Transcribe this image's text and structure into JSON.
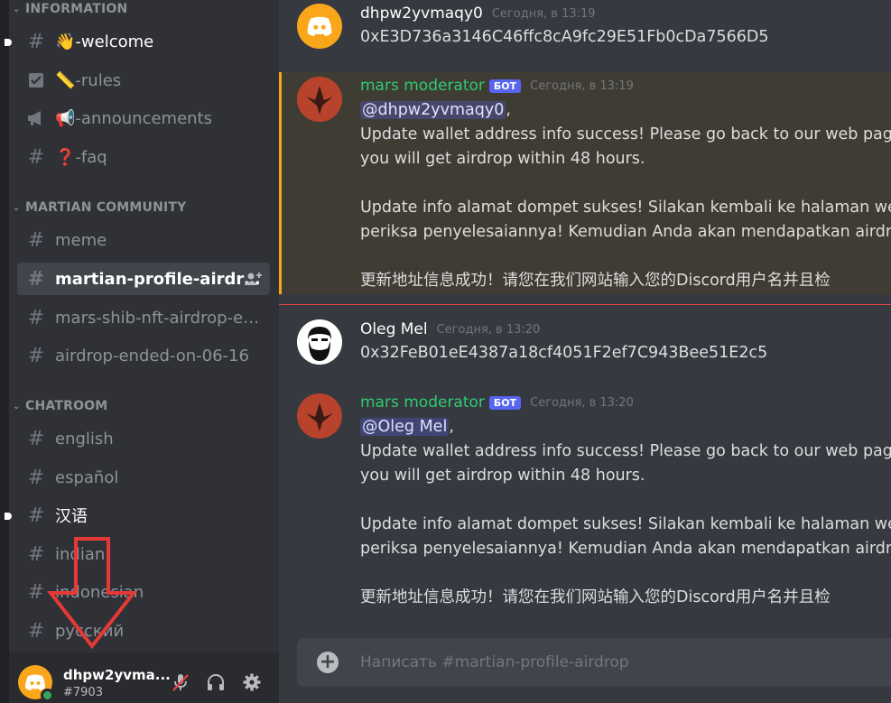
{
  "sidebar": {
    "categories": [
      {
        "label": "INFORMATION"
      },
      {
        "label": "MARTIAN COMMUNITY"
      },
      {
        "label": "CHATROOM"
      }
    ],
    "information_channels": [
      {
        "label": "👋-welcome",
        "icon": "hash-icon"
      },
      {
        "label": "📏-rules",
        "icon": "rules-checkbox-icon"
      },
      {
        "label": "📢-announcements",
        "icon": "megaphone-icon"
      },
      {
        "label": "❓-faq",
        "icon": "hash-icon"
      }
    ],
    "community_channels": [
      {
        "label": "meme",
        "icon": "hash-icon"
      },
      {
        "label": "martian-profile-airdrop",
        "icon": "hash-icon",
        "active": true
      },
      {
        "label": "mars-shib-nft-airdrop-en...",
        "icon": "hash-icon"
      },
      {
        "label": "airdrop-ended-on-06-16",
        "icon": "hash-icon"
      }
    ],
    "chatroom_channels": [
      {
        "label": "english",
        "icon": "hash-icon"
      },
      {
        "label": "español",
        "icon": "hash-icon"
      },
      {
        "label": "汉语",
        "icon": "hash-icon"
      },
      {
        "label": "indian",
        "icon": "hash-icon"
      },
      {
        "label": "indonesian",
        "icon": "hash-icon"
      },
      {
        "label": "русский",
        "icon": "hash-icon"
      }
    ]
  },
  "user_panel": {
    "username": "dhpw2yvma...",
    "tag": "#7903",
    "status_color": "#3ba55d",
    "avatar_color": "#faa61a"
  },
  "messages": [
    {
      "author": "dhpw2yvmaqy0",
      "timestamp": "Сегодня, в 13:19",
      "lines": [
        "0xE3D736a3146C46ffc8cA9fc29E51Fb0cDa7566D5"
      ]
    },
    {
      "author": "mars moderator",
      "bot": "БОТ",
      "timestamp": "Сегодня, в 13:19",
      "mention": "@dhpw2yvmaqy0",
      "lines": [
        "Update wallet address info success! Please go back to our web page, en",
        "you will get airdrop within 48 hours.",
        "",
        "Update info alamat dompet sukses! Silakan kembali ke halaman web ka",
        "periksa penyelesaiannya! Kemudian Anda akan mendapatkan airdrop d",
        "",
        "更新地址信息成功！请您在我们网站输入您的Discord用户名并且检"
      ]
    },
    {
      "author": "Oleg Mel",
      "timestamp": "Сегодня, в 13:20",
      "lines": [
        "0x32FeB01eE4387a18cf4051F2ef7C943Bee51E2c5"
      ]
    },
    {
      "author": "mars moderator",
      "bot": "БОТ",
      "timestamp": "Сегодня, в 13:20",
      "mention": "@Oleg Mel",
      "lines": [
        "Update wallet address info success! Please go back to our web page, en",
        "you will get airdrop within 48 hours.",
        "",
        "Update info alamat dompet sukses! Silakan kembali ke halaman web ka",
        "periksa penyelesaiannya! Kemudian Anda akan mendapatkan airdrop d",
        "",
        "更新地址信息成功！请您在我们网站输入您的Discord用户名并且检"
      ]
    }
  ],
  "composer": {
    "placeholder": "Написать #martian-profile-airdrop"
  },
  "colors": {
    "accent": "#5865f2",
    "moderator_name": "#2ecc71",
    "highlight_border": "#faa61a",
    "annotation_arrow": "#e53935"
  }
}
